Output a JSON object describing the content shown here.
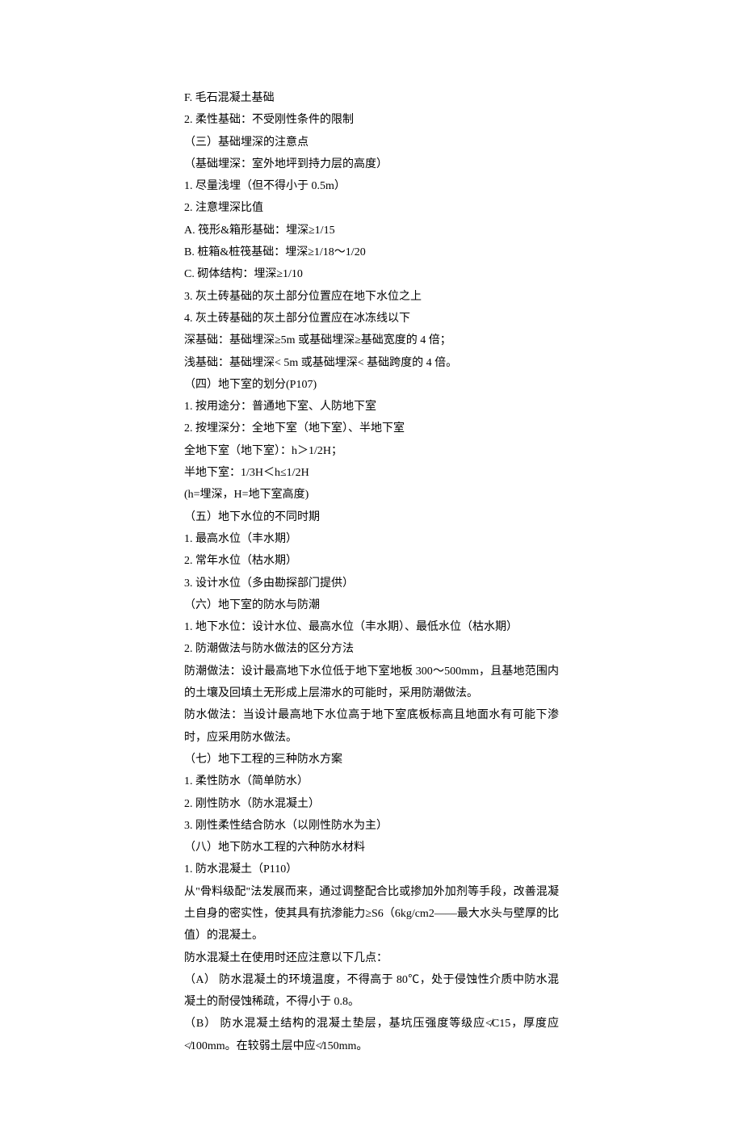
{
  "lines": [
    "F. 毛石混凝土基础",
    "2. 柔性基础：不受刚性条件的限制",
    "（三）基础埋深的注意点",
    "（基础埋深：室外地坪到持力层的高度）",
    "1. 尽量浅埋（但不得小于 0.5m）",
    "2. 注意埋深比值",
    "A. 筏形&箱形基础：埋深≥1/15",
    "B. 桩箱&桩筏基础：埋深≥1/18～1/20",
    "C. 砌体结构：埋深≥1/10",
    "3. 灰土砖基础的灰土部分位置应在地下水位之上",
    "4. 灰土砖基础的灰土部分位置应在冰冻线以下",
    "深基础：基础埋深≥5m 或基础埋深≥基础宽度的 4 倍；",
    "浅基础：基础埋深< 5m 或基础埋深< 基础跨度的 4 倍。",
    "（四）地下室的划分(P107)",
    "1. 按用途分：普通地下室、人防地下室",
    "2. 按埋深分：全地下室（地下室）、半地下室",
    "全地下室（地下室）：h＞1/2H；",
    "半地下室：1/3H＜h≤1/2H",
    "(h=埋深，H=地下室高度)",
    "（五）地下水位的不同时期",
    "1. 最高水位（丰水期）",
    "2. 常年水位（枯水期）",
    "3. 设计水位（多由勘探部门提供）",
    "（六）地下室的防水与防潮",
    "1. 地下水位：设计水位、最高水位（丰水期）、最低水位（枯水期）",
    "2. 防潮做法与防水做法的区分方法",
    "防潮做法：设计最高地下水位低于地下室地板 300～500mm，且基地范围内的土壤及回填土无形成上层滞水的可能时，采用防潮做法。",
    "防水做法：当设计最高地下水位高于地下室底板标高且地面水有可能下渗时，应采用防水做法。",
    "（七）地下工程的三种防水方案",
    "1. 柔性防水（简单防水）",
    "2. 刚性防水（防水混凝土）",
    "3. 刚性柔性结合防水（以刚性防水为主）",
    "（八）地下防水工程的六种防水材料",
    "1. 防水混凝土（P110）",
    "从\"骨料级配\"法发展而来，通过调整配合比或掺加外加剂等手段，改善混凝土自身的密实性，使其具有抗渗能力≥S6（6kg/cm2——最大水头与壁厚的比值）的混凝土。",
    "防水混凝土在使用时还应注意以下几点：",
    "（A） 防水混凝土的环境温度，不得高于 80℃，处于侵蚀性介质中防水混凝土的耐侵蚀稀疏，不得小于 0.8。",
    "（B） 防水混凝土结构的混凝土垫层，基坑压强度等级应≮C15，厚度应≮100mm。在较弱土层中应≮150mm。"
  ]
}
